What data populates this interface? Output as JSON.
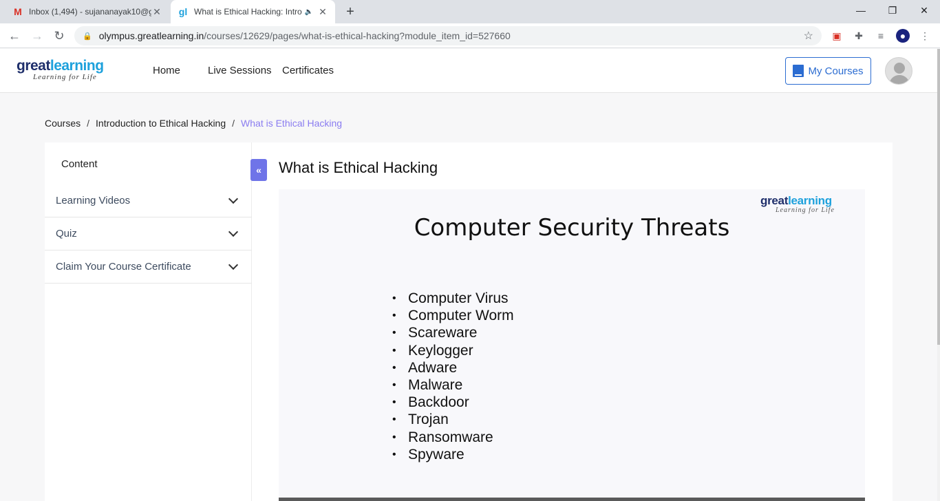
{
  "browser": {
    "tabs": [
      {
        "title": "Inbox (1,494) - sujananayak10@g",
        "favicon": "gmail-icon",
        "active": false
      },
      {
        "title": "What is Ethical Hacking: Intro",
        "favicon": "gl",
        "active": true
      }
    ],
    "url_host": "olympus.greatlearning.in",
    "url_path": "/courses/12629/pages/what-is-ethical-hacking?module_item_id=527660"
  },
  "header": {
    "logo_main_a": "great",
    "logo_main_b": "learning",
    "logo_tagline": "Learning for Life",
    "nav": [
      "Home",
      "Live Sessions",
      "Certificates"
    ],
    "my_courses": "My Courses"
  },
  "breadcrumb": {
    "items": [
      "Courses",
      "Introduction to Ethical Hacking",
      "What is Ethical Hacking"
    ],
    "separator": "/"
  },
  "sidebar": {
    "heading": "Content",
    "sections": [
      "Learning Videos",
      "Quiz",
      "Claim Your Course Certificate"
    ]
  },
  "main": {
    "title": "What is Ethical Hacking",
    "slide": {
      "logo_main_a": "great",
      "logo_main_b": "learning",
      "logo_tagline": "Learning for Life",
      "title": "Computer Security Threats",
      "bullets": [
        "Computer Virus",
        "Computer Worm",
        "Scareware",
        "Keylogger",
        "Adware",
        "Malware",
        "Backdoor",
        "Trojan",
        "Ransomware",
        "Spyware"
      ]
    }
  },
  "colors": {
    "accent": "#2b6cd1",
    "breadcrumb_current": "#8a7cf0",
    "collapse_button": "#6f74e8"
  }
}
